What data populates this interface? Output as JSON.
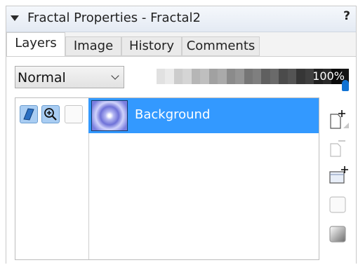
{
  "window": {
    "title": "Fractal Properties - Fractal2",
    "help": "?"
  },
  "tabs": [
    {
      "label": "Layers",
      "active": true
    },
    {
      "label": "Image",
      "active": false
    },
    {
      "label": "History",
      "active": false
    },
    {
      "label": "Comments",
      "active": false
    }
  ],
  "layers_panel": {
    "blend_mode": "Normal",
    "opacity": {
      "label": "100%",
      "value": 1.0
    },
    "layers": [
      {
        "name": "Background",
        "selected": true
      }
    ],
    "row_icons": [
      "paint-mode-icon",
      "zoom-in-icon",
      "blank-toggle-icon"
    ]
  },
  "side_buttons": [
    "new-layer-icon",
    "delete-layer-icon",
    "new-group-icon",
    "blank-icon",
    "gradient-icon"
  ],
  "colors": {
    "selection": "#3399ff",
    "thumb": "#1173d4",
    "tab_border": "#d0d0d0"
  }
}
